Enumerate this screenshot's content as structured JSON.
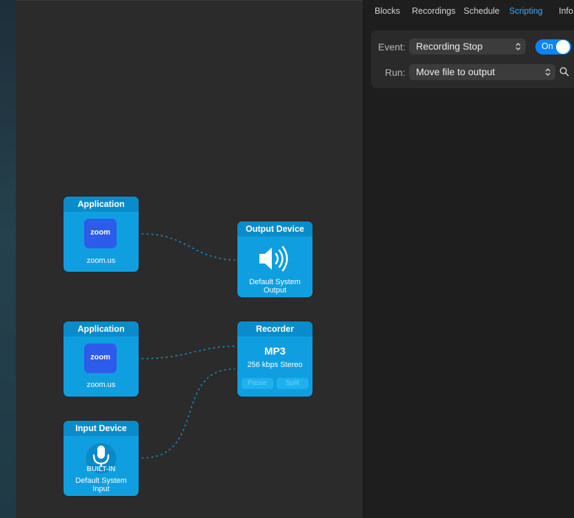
{
  "tabs": [
    {
      "label": "Blocks",
      "active": false
    },
    {
      "label": "Recordings",
      "active": false
    },
    {
      "label": "Schedule",
      "active": false
    },
    {
      "label": "Scripting",
      "active": true
    },
    {
      "label": "Info",
      "active": false
    }
  ],
  "scripting": {
    "event_label": "Event:",
    "event_value": "Recording Stop",
    "toggle_label": "On",
    "toggle_on": true,
    "run_label": "Run:",
    "run_value": "Move file to output"
  },
  "blocks": {
    "app1": {
      "header": "Application",
      "icon_text": "zoom",
      "caption": "zoom.us"
    },
    "app2": {
      "header": "Application",
      "icon_text": "zoom",
      "caption": "zoom.us"
    },
    "output": {
      "header": "Output Device",
      "caption": "Default System Output",
      "icon": "speaker-icon"
    },
    "recorder": {
      "header": "Recorder",
      "format": "MP3",
      "quality": "256 kbps Stereo",
      "pause_label": "Pause",
      "split_label": "Split"
    },
    "input": {
      "header": "Input Device",
      "badge": "BUILT-IN",
      "caption": "Default System Input",
      "icon": "microphone-icon"
    }
  },
  "colors": {
    "accent": "#3aa8f0",
    "block": "#0f9fe0",
    "block_header": "#0b8cca",
    "toggle": "#0a84ff"
  }
}
